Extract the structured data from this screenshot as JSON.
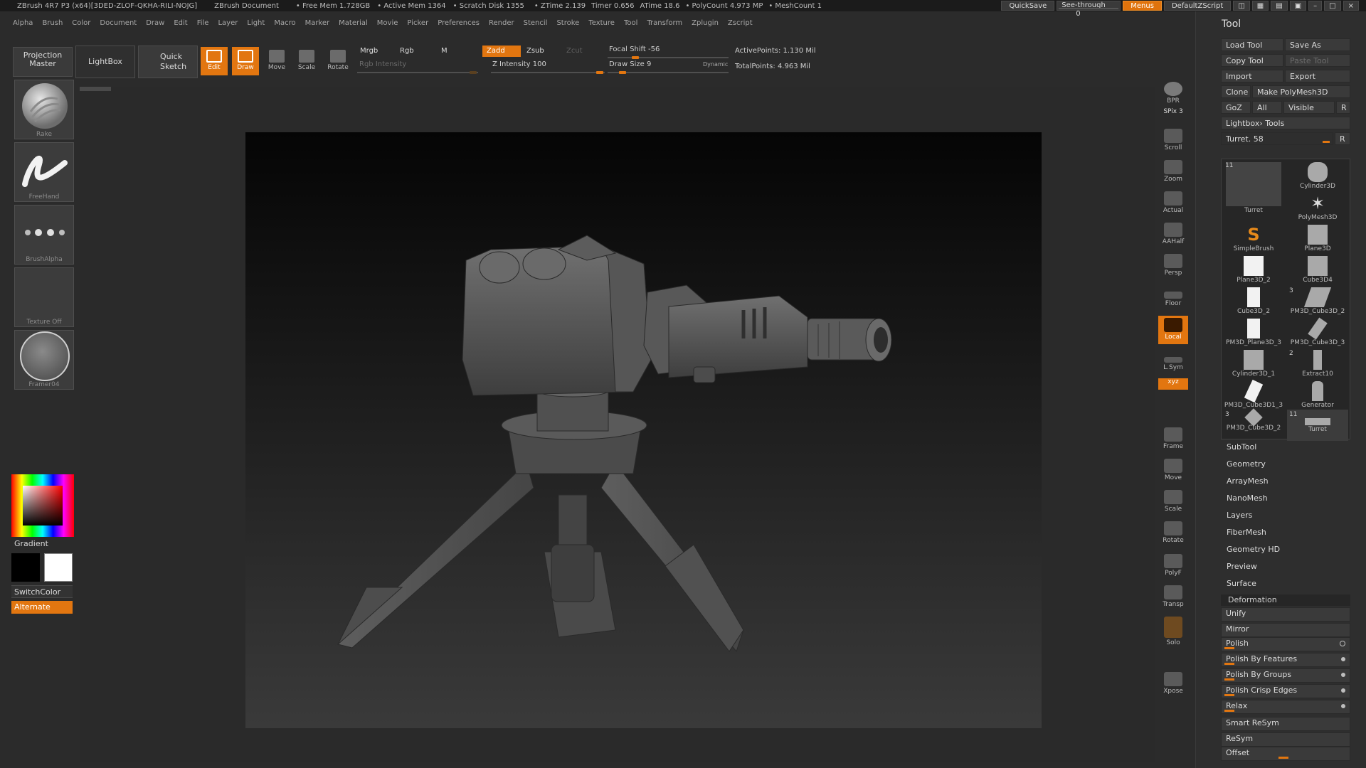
{
  "titlebar": {
    "app": "ZBrush 4R7 P3 (x64)[3DED-ZLOF-QKHA-RILI-NOJG]",
    "doc": "ZBrush Document",
    "free_mem": "• Free Mem 1.728GB",
    "active_mem": "• Active Mem 1364",
    "scratch": "• Scratch Disk 1355",
    "ztime": "• ZTime 2.139",
    "timer": "Timer 0.656",
    "atime": "ATime 18.6",
    "polycount": "• PolyCount 4.973 MP",
    "meshcount": "• MeshCount 1",
    "quicksave": "QuickSave",
    "seethrough": "See-through",
    "seethrough_value": "0",
    "menus": "Menus",
    "zscript": "DefaultZScript"
  },
  "menubar": [
    "Alpha",
    "Brush",
    "Color",
    "Document",
    "Draw",
    "Edit",
    "File",
    "Layer",
    "Light",
    "Macro",
    "Marker",
    "Material",
    "Movie",
    "Picker",
    "Preferences",
    "Render",
    "Stencil",
    "Stroke",
    "Texture",
    "Tool",
    "Transform",
    "Zplugin",
    "Zscript"
  ],
  "toolbar": {
    "projection_master": "Projection Master",
    "lightbox": "LightBox",
    "quick_sketch": "Quick Sketch",
    "edit": "Edit",
    "draw": "Draw",
    "move": "Move",
    "scale": "Scale",
    "rotate": "Rotate",
    "mrgb": "Mrgb",
    "rgb": "Rgb",
    "m": "M",
    "rgb_intensity": "Rgb Intensity",
    "zadd": "Zadd",
    "zsub": "Zsub",
    "zcut": "Zcut",
    "z_intensity": "Z Intensity 100",
    "focal_shift": "Focal Shift -56",
    "draw_size": "Draw Size 9",
    "dynamic": "Dynamic",
    "active_points": "ActivePoints: 1.130 Mil",
    "total_points": "TotalPoints: 4.963 Mil"
  },
  "leftshelf": {
    "brush": "Rake",
    "stroke": "FreeHand",
    "alpha": "BrushAlpha",
    "texture": "Texture Off",
    "material": "Framer04",
    "gradient": "Gradient",
    "switch_color": "SwitchColor",
    "alternate": "Alternate"
  },
  "rightshelf": [
    {
      "label": "BPR"
    },
    {
      "label": "SPix 3"
    },
    {
      "label": "Scroll"
    },
    {
      "label": "Zoom"
    },
    {
      "label": "Actual"
    },
    {
      "label": "AAHalf"
    },
    {
      "label": "Persp"
    },
    {
      "label": "Floor"
    },
    {
      "label": "Local"
    },
    {
      "label": "L.Sym"
    },
    {
      "label": "xyz"
    },
    {
      "label": "Frame"
    },
    {
      "label": "Move"
    },
    {
      "label": "Scale"
    },
    {
      "label": "Rotate"
    },
    {
      "label": "PolyF"
    },
    {
      "label": "Transp"
    },
    {
      "label": "Solo"
    },
    {
      "label": "Xpose"
    }
  ],
  "toolpalette": {
    "title": "Tool",
    "load_tool": "Load Tool",
    "save_as": "Save As",
    "copy_tool": "Copy Tool",
    "paste_tool": "Paste Tool",
    "import": "Import",
    "export": "Export",
    "clone": "Clone",
    "make_polymesh": "Make PolyMesh3D",
    "goz": "GoZ",
    "all": "All",
    "visible": "Visible",
    "r": "R",
    "lightbox_tools": "Lightbox› Tools",
    "current_tool": "Turret. 58",
    "thumbs": [
      {
        "name": "Turret",
        "badge": "11"
      },
      {
        "name": "Cylinder3D",
        "badge": ""
      },
      {
        "name": "PolyMesh3D",
        "badge": ""
      },
      {
        "name": "SimpleBrush",
        "badge": ""
      },
      {
        "name": "Plane3D",
        "badge": ""
      },
      {
        "name": "Plane3D_2",
        "badge": ""
      },
      {
        "name": "Cube3D4",
        "badge": ""
      },
      {
        "name": "Cube3D_2",
        "badge": ""
      },
      {
        "name": "PM3D_Cube3D_2",
        "badge": "3"
      },
      {
        "name": "PM3D_Plane3D_3",
        "badge": ""
      },
      {
        "name": "PM3D_Cube3D_3",
        "badge": ""
      },
      {
        "name": "Cylinder3D_1",
        "badge": ""
      },
      {
        "name": "Extract10",
        "badge": "2"
      },
      {
        "name": "PM3D_Cube3D1_3",
        "badge": ""
      },
      {
        "name": "Generator",
        "badge": ""
      },
      {
        "name": "PM3D_Cube3D_2",
        "badge": "3"
      },
      {
        "name": "Turret",
        "badge": "11"
      }
    ],
    "sections": [
      "SubTool",
      "Geometry",
      "ArrayMesh",
      "NanoMesh",
      "Layers",
      "FiberMesh",
      "Geometry HD",
      "Preview",
      "Surface"
    ],
    "deformation": "Deformation",
    "deform_items": [
      "Unify",
      "Mirror",
      "Polish",
      "Polish By Features",
      "Polish By Groups",
      "Polish Crisp Edges",
      "Relax",
      "Smart ReSym",
      "ReSym",
      "Offset"
    ]
  },
  "colors": {
    "accent": "#e27610",
    "panel": "#3a3a3a",
    "background": "#2b2b2b"
  }
}
